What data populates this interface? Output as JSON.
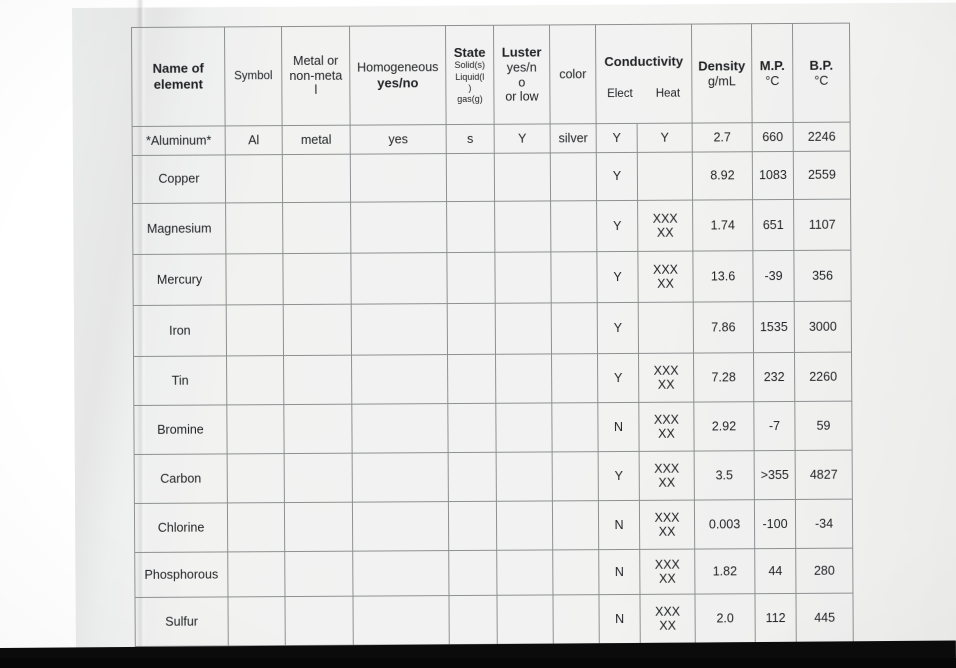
{
  "document": {
    "kind": "photographed-worksheet",
    "table_name": "element-properties-table"
  },
  "colors": {
    "paper": "#f1f1f0",
    "grid_line": "#8d9091",
    "ink_black": "#232427",
    "ink_blue": "#2c2fa8",
    "ink_red": "#b7556a",
    "dark_bar": "#0b0b0c"
  },
  "table": {
    "headers": {
      "name": {
        "line1": "Name of",
        "line2": "element"
      },
      "symbol": "Symbol",
      "metal": {
        "line1": "Metal or",
        "line2": "non-meta",
        "line3": "l"
      },
      "homogeneous": {
        "line1": "Homogeneous",
        "line2": "yes/no"
      },
      "state": {
        "title": "State",
        "line1": "Solid(s)",
        "line2": "Liquid(l",
        "line3": ")",
        "line4": "gas(g)"
      },
      "luster": {
        "title": "Luster",
        "line1": "yes/n",
        "line2": "o",
        "line3": "or low"
      },
      "color": "color",
      "conductivity": {
        "title": "Conductivity",
        "sub1": "Elect",
        "sub2": "Heat"
      },
      "density": {
        "line1": "Density",
        "line2": "g/mL"
      },
      "mp": {
        "line1": "M.P.",
        "line2": "°C"
      },
      "bp": {
        "line1": "B.P.",
        "line2": "°C"
      }
    },
    "rows": [
      {
        "name": "*Aluminum*",
        "symbol": "Al",
        "metal": "metal",
        "homogeneous": "yes",
        "state": "s",
        "luster": "Y",
        "color": "silver",
        "elect": "Y",
        "heat": "Y",
        "density": "2.7",
        "mp": "660",
        "bp": "2246",
        "ink": "blue"
      },
      {
        "name": "Copper",
        "symbol": "",
        "metal": "",
        "homogeneous": "",
        "state": "",
        "luster": "",
        "color": "",
        "elect": "Y",
        "heat": "",
        "density": "8.92",
        "mp": "1083",
        "bp": "2559",
        "ink": "black"
      },
      {
        "name": "Magnesium",
        "symbol": "",
        "metal": "",
        "homogeneous": "",
        "state": "",
        "luster": "",
        "color": "",
        "elect": "Y",
        "heat": "XXXXX",
        "density": "1.74",
        "mp": "651",
        "bp": "1107",
        "ink": "black"
      },
      {
        "name": "Mercury",
        "symbol": "",
        "metal": "",
        "homogeneous": "",
        "state": "",
        "luster": "",
        "color": "",
        "elect": "Y",
        "heat": "XXXXX",
        "density": "13.6",
        "mp": "-39",
        "bp": "356",
        "ink": "black"
      },
      {
        "name": "Iron",
        "symbol": "",
        "metal": "",
        "homogeneous": "",
        "state": "",
        "luster": "",
        "color": "",
        "elect": "Y",
        "heat": "",
        "density": "7.86",
        "mp": "1535",
        "bp": "3000",
        "ink": "black"
      },
      {
        "name": "Tin",
        "symbol": "",
        "metal": "",
        "homogeneous": "",
        "state": "",
        "luster": "",
        "color": "",
        "elect": "Y",
        "heat": "XXXXX",
        "density": "7.28",
        "mp": "232",
        "bp": "2260",
        "ink": "black"
      },
      {
        "name": "Bromine",
        "symbol": "",
        "metal": "",
        "homogeneous": "",
        "state": "",
        "luster": "",
        "color": "",
        "elect": "N",
        "heat": "XXXXX",
        "density": "2.92",
        "mp": "-7",
        "bp": "59",
        "ink": "black"
      },
      {
        "name": "Carbon",
        "symbol": "",
        "metal": "",
        "homogeneous": "",
        "state": "",
        "luster": "",
        "color": "",
        "elect": "Y",
        "heat": "XXXXX",
        "density": "3.5",
        "mp": ">355",
        "bp": "4827",
        "ink": "black",
        "elect_ink": "red"
      },
      {
        "name": "Chlorine",
        "symbol": "",
        "metal": "",
        "homogeneous": "",
        "state": "",
        "luster": "",
        "color": "",
        "elect": "N",
        "heat": "XXXXX",
        "density": "0.003",
        "mp": "-100",
        "bp": "-34",
        "ink": "black"
      },
      {
        "name": "Phosphorous",
        "symbol": "",
        "metal": "",
        "homogeneous": "",
        "state": "",
        "luster": "",
        "color": "",
        "elect": "N",
        "heat": "XXXXX",
        "density": "1.82",
        "mp": "44",
        "bp": "280",
        "ink": "black"
      },
      {
        "name": "Sulfur",
        "symbol": "",
        "metal": "",
        "homogeneous": "",
        "state": "",
        "luster": "",
        "color": "",
        "elect": "N",
        "heat": "XXXXX",
        "density": "2.0",
        "mp": "112",
        "bp": "445",
        "ink": "black"
      }
    ]
  }
}
